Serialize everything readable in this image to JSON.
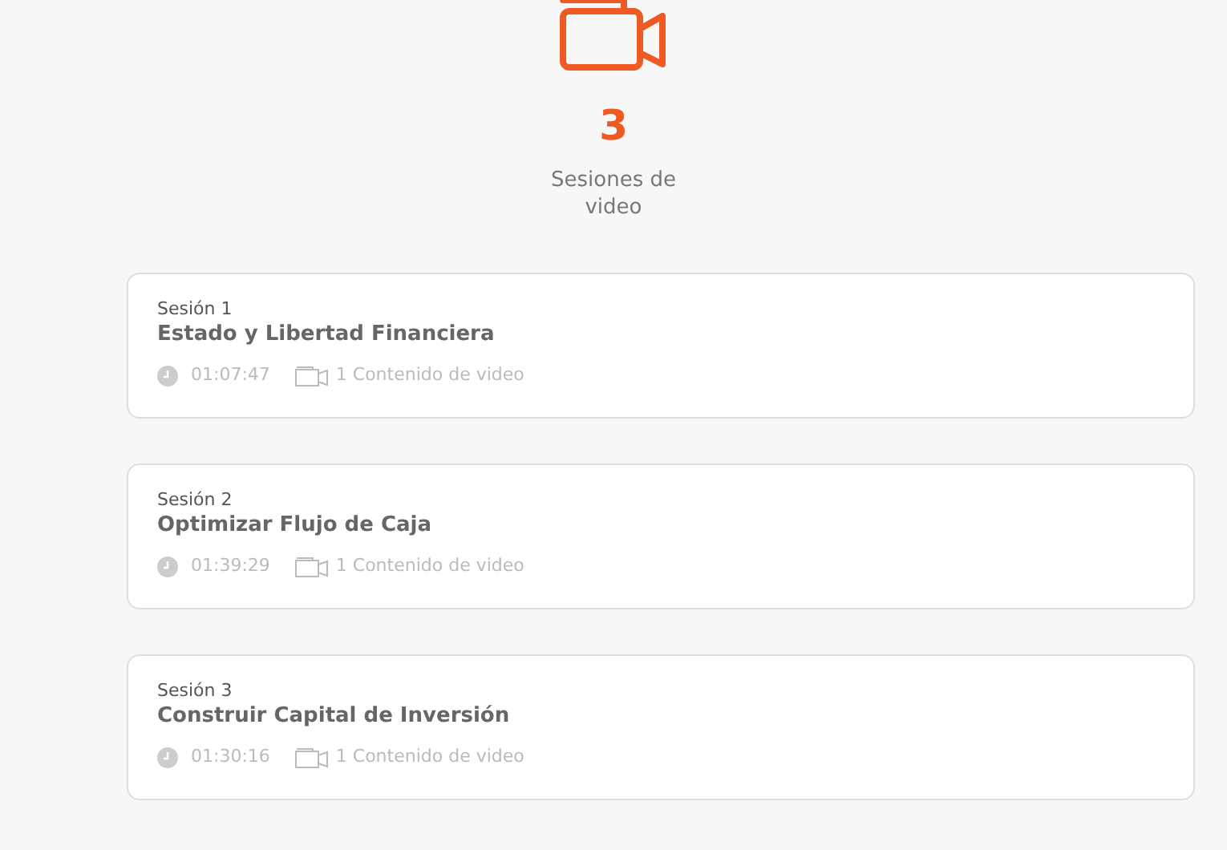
{
  "summary": {
    "count": "3",
    "label": "Sesiones de video"
  },
  "sessions": [
    {
      "number": "Sesión 1",
      "title": "Estado y Libertad Financiera",
      "duration": "01:07:47",
      "content": "1 Contenido de video"
    },
    {
      "number": "Sesión 2",
      "title": "Optimizar Flujo de Caja",
      "duration": "01:39:29",
      "content": "1 Contenido de video"
    },
    {
      "number": "Sesión 3",
      "title": "Construir Capital de Inversión",
      "duration": "01:30:16",
      "content": "1 Contenido de video"
    }
  ]
}
